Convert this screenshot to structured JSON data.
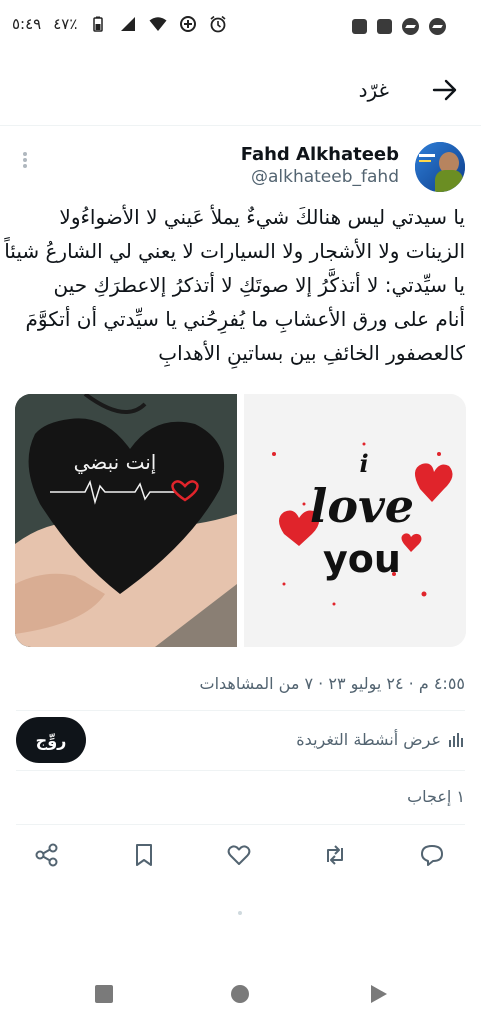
{
  "status_bar": {
    "time": "٥:٤٩",
    "battery": "٤٧٪"
  },
  "header": {
    "title": "غرّد"
  },
  "tweet": {
    "author_name": "Fahd Alkhateeb",
    "author_handle": "@alkhateeb_fahd",
    "text_lines": [
      "يا سيدتي ليس هنالكَ شيءٌ يملأ عَيني لا الأضواءُولا",
      "الزينات ولا الأشجار ولا السيارات لا يعني لي الشارعُ شيئاً",
      "يا سيِّدتي: لا أتذكَّرُ إلا صوتَكِ لا أتذكرُ إلاعطرَكِ حين",
      "أنام على ورق الأعشابِ ما يُفرِحُني يا سيِّدتي أن أتكوَّمَ",
      "كالعصفور الخائفِ بين بساتينِ الأهدابِ"
    ],
    "image_left_text": "إنت نبضي",
    "image_right_text": [
      "i",
      "love",
      "you"
    ],
    "meta": "٤:٥٥ م · ٢٤ يوليو ٢٣ · ٧ من المشاهدات",
    "reply_label": "روِّج",
    "activity_label": "عرض أنشطة التغريدة",
    "likes_label": "١ إعجاب"
  },
  "colors": {
    "text_primary": "#0f1419",
    "text_secondary": "#536471",
    "divider": "#eff3f4",
    "heart_red": "#e0242b"
  }
}
